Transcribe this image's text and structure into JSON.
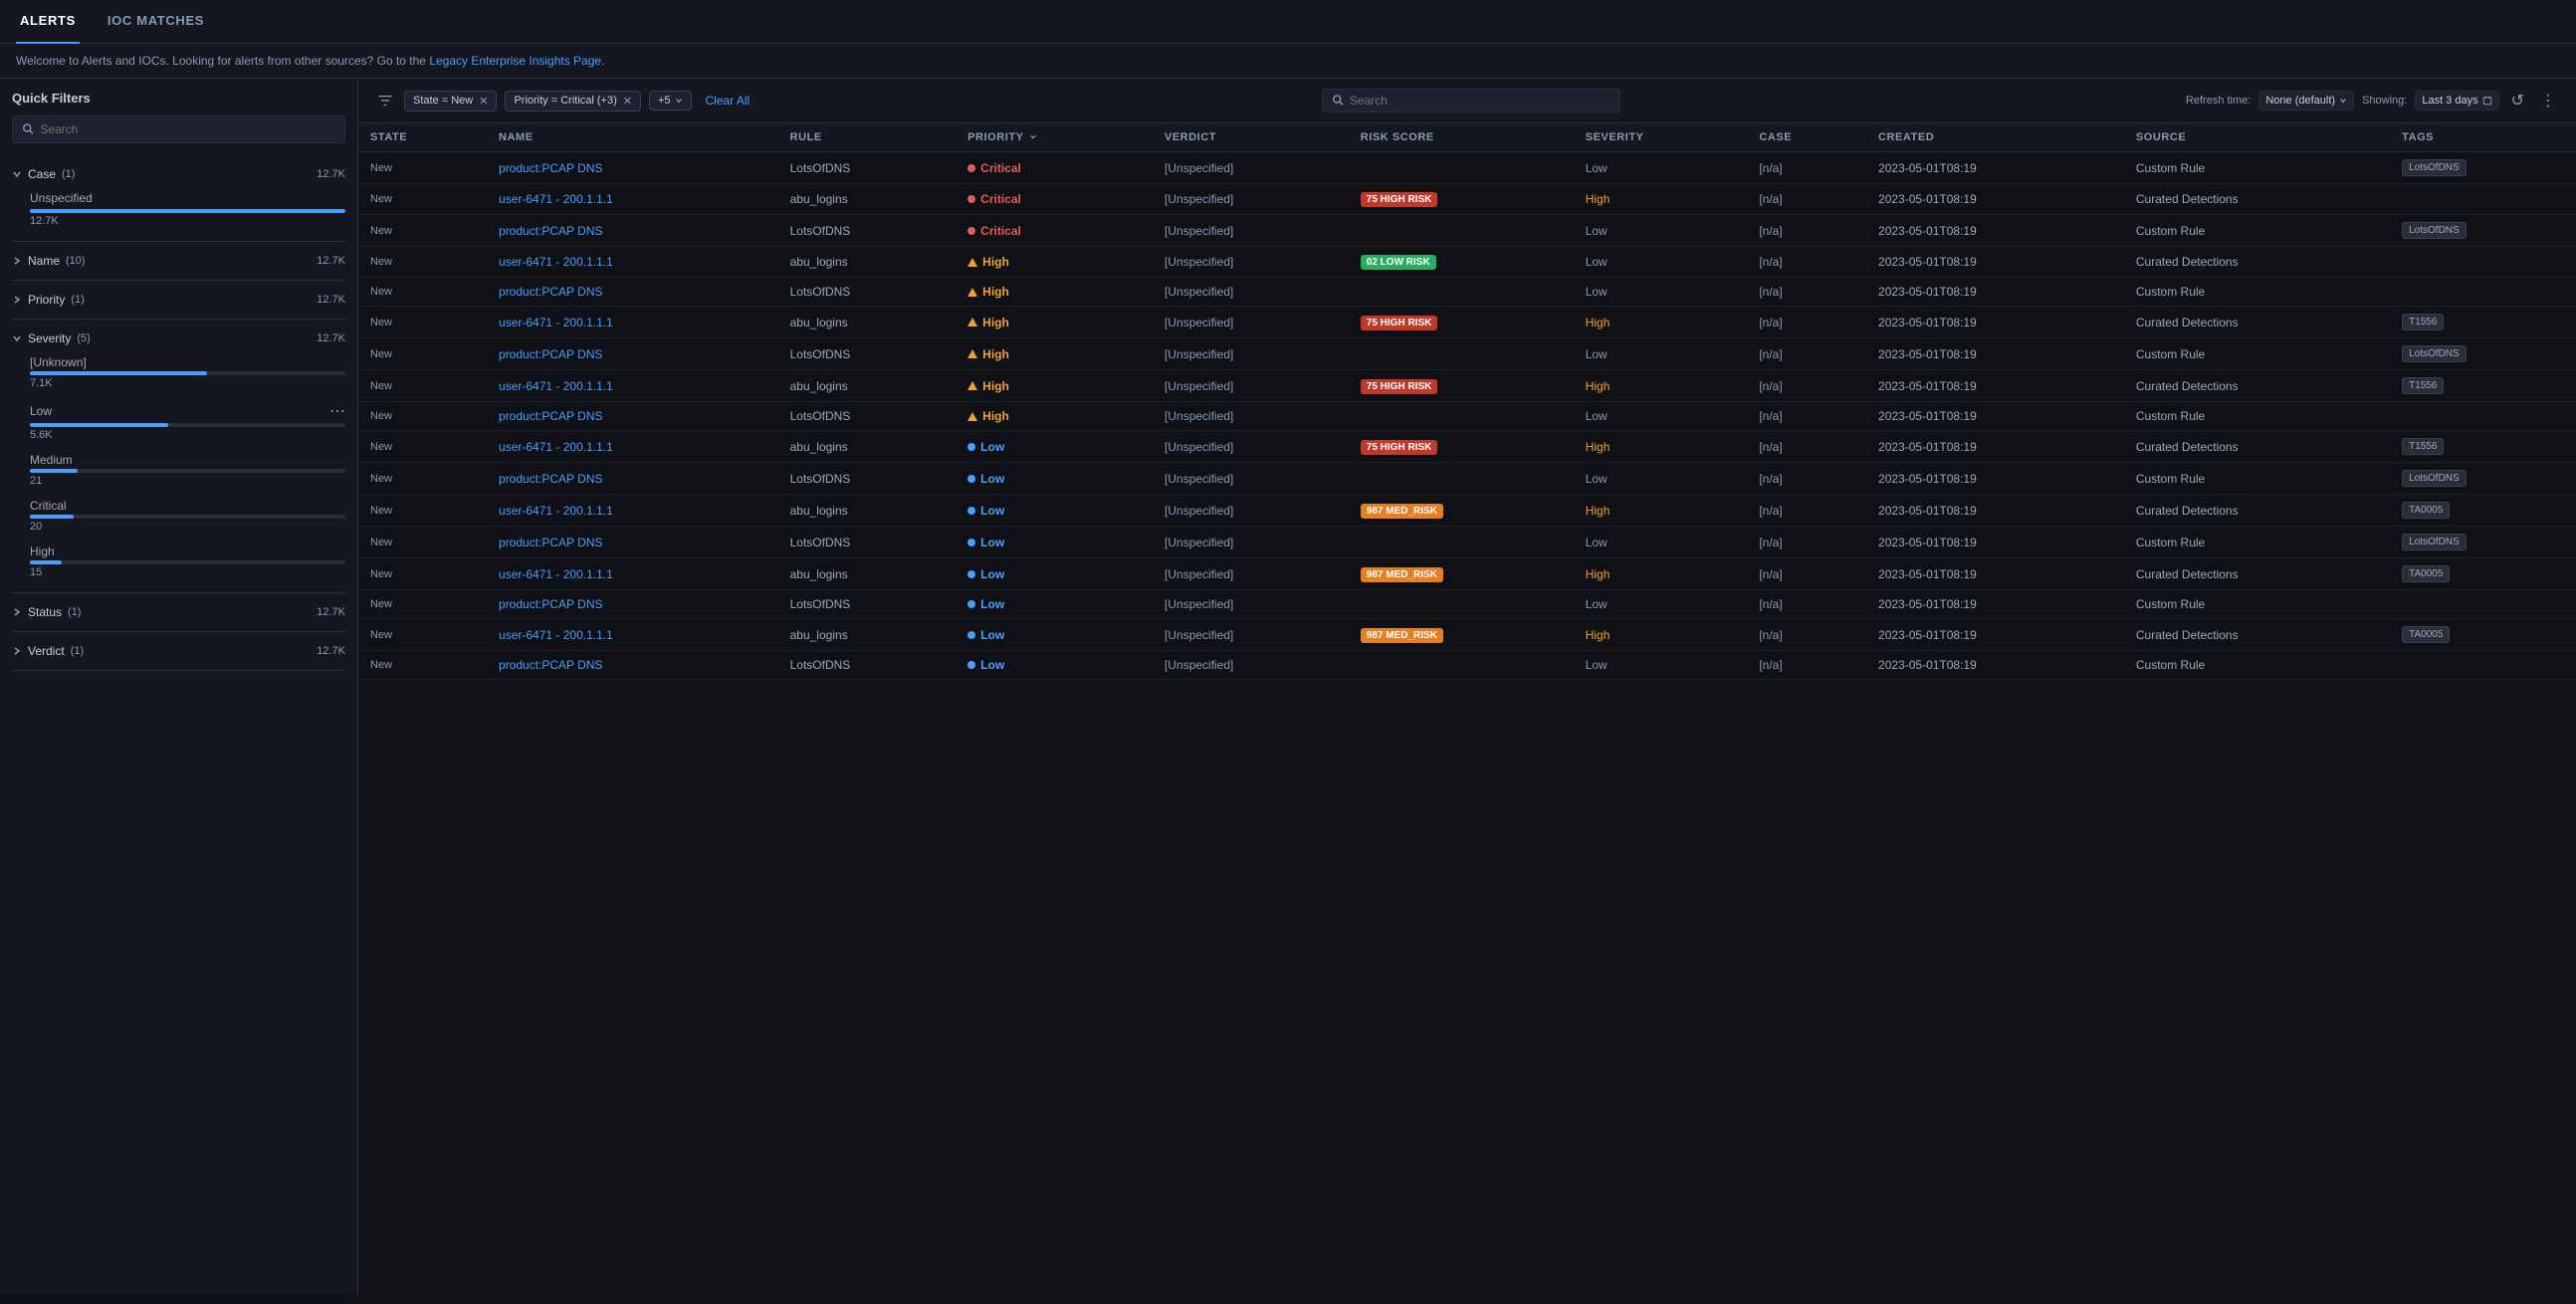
{
  "nav": {
    "tabs": [
      {
        "label": "ALERTS",
        "active": true
      },
      {
        "label": "IOC MATCHES",
        "active": false
      }
    ]
  },
  "banner": {
    "text": "Welcome to Alerts and IOCs. Looking for alerts from other sources? Go to the ",
    "link_text": "Legacy Enterprise Insights Page.",
    "link_url": "#"
  },
  "sidebar": {
    "title": "Quick Filters",
    "search_placeholder": "Search",
    "sections": [
      {
        "name": "Case",
        "count": "(1)",
        "total": "12.7K",
        "expanded": true,
        "items": [
          {
            "label": "Unspecified",
            "value": "12.7K",
            "pct": 100
          }
        ]
      },
      {
        "name": "Name",
        "count": "(10)",
        "total": "12.7K",
        "expanded": false,
        "items": []
      },
      {
        "name": "Priority",
        "count": "(1)",
        "total": "12.7K",
        "expanded": false,
        "items": []
      },
      {
        "name": "Severity",
        "count": "(5)",
        "total": "12.7K",
        "expanded": true,
        "items": [
          {
            "label": "[Unknown]",
            "value": "7.1K",
            "pct": 56
          },
          {
            "label": "Low",
            "value": "5.6K",
            "pct": 44,
            "has_dots": true
          },
          {
            "label": "Medium",
            "value": "21",
            "pct": 15
          },
          {
            "label": "Critical",
            "value": "20",
            "pct": 14
          },
          {
            "label": "High",
            "value": "15",
            "pct": 10
          }
        ]
      },
      {
        "name": "Status",
        "count": "(1)",
        "total": "12.7K",
        "expanded": false,
        "items": []
      },
      {
        "name": "Verdict",
        "count": "(1)",
        "total": "12.7K",
        "expanded": false,
        "items": []
      }
    ]
  },
  "toolbar": {
    "filter_chips": [
      {
        "label": "State = New",
        "removable": true
      },
      {
        "label": "Priority = Critical (+3)",
        "removable": true
      }
    ],
    "plus_chip_label": "+5",
    "clear_label": "Clear All",
    "search_placeholder": "Search",
    "refresh_label": "Refresh time:",
    "refresh_value": "None (default)",
    "showing_label": "Showing:",
    "showing_value": "Last 3 days"
  },
  "table": {
    "columns": [
      "STATE",
      "NAME",
      "RULE",
      "PRIORITY",
      "VERDICT",
      "RISK SCORE",
      "SEVERITY",
      "CASE",
      "CREATED",
      "SOURCE",
      "TAGS"
    ],
    "rows": [
      {
        "state": "New",
        "name": "product:PCAP DNS",
        "rule": "LotsOfDNS",
        "priority": "Critical",
        "verdict": "[Unspecified]",
        "risk_score": null,
        "severity": "Low",
        "case": "[n/a]",
        "created": "2023-05-01T08:19",
        "source": "Custom Rule",
        "tags": [
          "LotsOfDNS"
        ]
      },
      {
        "state": "New",
        "name": "user-6471 - 200.1.1.1",
        "rule": "abu_logins",
        "priority": "Critical",
        "verdict": "[Unspecified]",
        "risk_score": {
          "value": "75",
          "label": "HIGH RISK",
          "type": "high"
        },
        "severity": "High",
        "case": "[n/a]",
        "created": "2023-05-01T08:19",
        "source": "Curated Detections",
        "tags": []
      },
      {
        "state": "New",
        "name": "product:PCAP DNS",
        "rule": "LotsOfDNS",
        "priority": "Critical",
        "verdict": "[Unspecified]",
        "risk_score": null,
        "severity": "Low",
        "case": "[n/a]",
        "created": "2023-05-01T08:19",
        "source": "Custom Rule",
        "tags": [
          "LotsOfDNS"
        ]
      },
      {
        "state": "New",
        "name": "user-6471 - 200.1.1.1",
        "rule": "abu_logins",
        "priority": "High",
        "verdict": "[Unspecified]",
        "risk_score": {
          "value": "02",
          "label": "LOW RISK",
          "type": "low"
        },
        "severity": "Low",
        "case": "[n/a]",
        "created": "2023-05-01T08:19",
        "source": "Curated Detections",
        "tags": []
      },
      {
        "state": "New",
        "name": "product:PCAP DNS",
        "rule": "LotsOfDNS",
        "priority": "High",
        "verdict": "[Unspecified]",
        "risk_score": null,
        "severity": "Low",
        "case": "[n/a]",
        "created": "2023-05-01T08:19",
        "source": "Custom Rule",
        "tags": []
      },
      {
        "state": "New",
        "name": "user-6471 - 200.1.1.1",
        "rule": "abu_logins",
        "priority": "High",
        "verdict": "[Unspecified]",
        "risk_score": {
          "value": "75",
          "label": "HIGH RISK",
          "type": "high"
        },
        "severity": "High",
        "case": "[n/a]",
        "created": "2023-05-01T08:19",
        "source": "Curated Detections",
        "tags": [
          "T1556"
        ]
      },
      {
        "state": "New",
        "name": "product:PCAP DNS",
        "rule": "LotsOfDNS",
        "priority": "High",
        "verdict": "[Unspecified]",
        "risk_score": null,
        "severity": "Low",
        "case": "[n/a]",
        "created": "2023-05-01T08:19",
        "source": "Custom Rule",
        "tags": [
          "LotsOfDNS"
        ]
      },
      {
        "state": "New",
        "name": "user-6471 - 200.1.1.1",
        "rule": "abu_logins",
        "priority": "High",
        "verdict": "[Unspecified]",
        "risk_score": {
          "value": "75",
          "label": "HIGH RISK",
          "type": "high"
        },
        "severity": "High",
        "case": "[n/a]",
        "created": "2023-05-01T08:19",
        "source": "Curated Detections",
        "tags": [
          "T1556"
        ]
      },
      {
        "state": "New",
        "name": "product:PCAP DNS",
        "rule": "LotsOfDNS",
        "priority": "High",
        "verdict": "[Unspecified]",
        "risk_score": null,
        "severity": "Low",
        "case": "[n/a]",
        "created": "2023-05-01T08:19",
        "source": "Custom Rule",
        "tags": []
      },
      {
        "state": "New",
        "name": "user-6471 - 200.1.1.1",
        "rule": "abu_logins",
        "priority": "Low",
        "verdict": "[Unspecified]",
        "risk_score": {
          "value": "75",
          "label": "HIGH RISK",
          "type": "high"
        },
        "severity": "High",
        "case": "[n/a]",
        "created": "2023-05-01T08:19",
        "source": "Curated Detections",
        "tags": [
          "T1556"
        ]
      },
      {
        "state": "New",
        "name": "product:PCAP DNS",
        "rule": "LotsOfDNS",
        "priority": "Low",
        "verdict": "[Unspecified]",
        "risk_score": null,
        "severity": "Low",
        "case": "[n/a]",
        "created": "2023-05-01T08:19",
        "source": "Custom Rule",
        "tags": [
          "LotsOfDNS"
        ]
      },
      {
        "state": "New",
        "name": "user-6471 - 200.1.1.1",
        "rule": "abu_logins",
        "priority": "Low",
        "verdict": "[Unspecified]",
        "risk_score": {
          "value": "987",
          "label": "MED_RISK",
          "type": "med"
        },
        "severity": "High",
        "case": "[n/a]",
        "created": "2023-05-01T08:19",
        "source": "Curated Detections",
        "tags": [
          "TA0005"
        ]
      },
      {
        "state": "New",
        "name": "product:PCAP DNS",
        "rule": "LotsOfDNS",
        "priority": "Low",
        "verdict": "[Unspecified]",
        "risk_score": null,
        "severity": "Low",
        "case": "[n/a]",
        "created": "2023-05-01T08:19",
        "source": "Custom Rule",
        "tags": [
          "LotsOfDNS"
        ]
      },
      {
        "state": "New",
        "name": "user-6471 - 200.1.1.1",
        "rule": "abu_logins",
        "priority": "Low",
        "verdict": "[Unspecified]",
        "risk_score": {
          "value": "987",
          "label": "MED_RISK",
          "type": "med"
        },
        "severity": "High",
        "case": "[n/a]",
        "created": "2023-05-01T08:19",
        "source": "Curated Detections",
        "tags": [
          "TA0005"
        ]
      },
      {
        "state": "New",
        "name": "product:PCAP DNS",
        "rule": "LotsOfDNS",
        "priority": "Low",
        "verdict": "[Unspecified]",
        "risk_score": null,
        "severity": "Low",
        "case": "[n/a]",
        "created": "2023-05-01T08:19",
        "source": "Custom Rule",
        "tags": []
      },
      {
        "state": "New",
        "name": "user-6471 - 200.1.1.1",
        "rule": "abu_logins",
        "priority": "Low",
        "verdict": "[Unspecified]",
        "risk_score": {
          "value": "987",
          "label": "MED_RISK",
          "type": "med"
        },
        "severity": "High",
        "case": "[n/a]",
        "created": "2023-05-01T08:19",
        "source": "Curated Detections",
        "tags": [
          "TA0005"
        ]
      },
      {
        "state": "New",
        "name": "product:PCAP DNS",
        "rule": "LotsOfDNS",
        "priority": "Low",
        "verdict": "[Unspecified]",
        "risk_score": null,
        "severity": "Low",
        "case": "[n/a]",
        "created": "2023-05-01T08:19",
        "source": "Custom Rule",
        "tags": []
      }
    ]
  }
}
